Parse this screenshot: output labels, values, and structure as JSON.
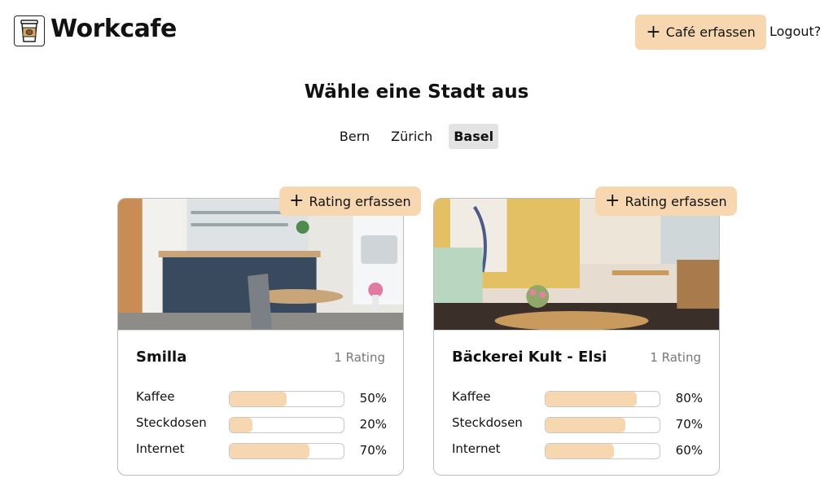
{
  "header": {
    "brand": "Workcafe",
    "add_cafe_label": "Café erfassen",
    "logout_label": "Logout?"
  },
  "main": {
    "heading": "Wähle eine Stadt aus",
    "cities": [
      {
        "label": "Bern",
        "active": false
      },
      {
        "label": "Zürich",
        "active": false
      },
      {
        "label": "Basel",
        "active": true
      }
    ]
  },
  "cafes": [
    {
      "name": "Smilla",
      "rating_count": "1 Rating",
      "rate_label": "Rating erfassen",
      "metrics": [
        {
          "label": "Kaffee",
          "value": 50,
          "display": "50%"
        },
        {
          "label": "Steckdosen",
          "value": 20,
          "display": "20%"
        },
        {
          "label": "Internet",
          "value": 70,
          "display": "70%"
        }
      ]
    },
    {
      "name": "Bäckerei Kult - Elsi",
      "rating_count": "1 Rating",
      "rate_label": "Rating erfassen",
      "metrics": [
        {
          "label": "Kaffee",
          "value": 80,
          "display": "80%"
        },
        {
          "label": "Steckdosen",
          "value": 70,
          "display": "70%"
        },
        {
          "label": "Internet",
          "value": 60,
          "display": "60%"
        }
      ]
    }
  ],
  "colors": {
    "accent": "#f7d7b0",
    "active_city_bg": "#e3e3e3"
  },
  "icons": {
    "logo": "coffee-cup-icon",
    "add": "plus-icon"
  }
}
